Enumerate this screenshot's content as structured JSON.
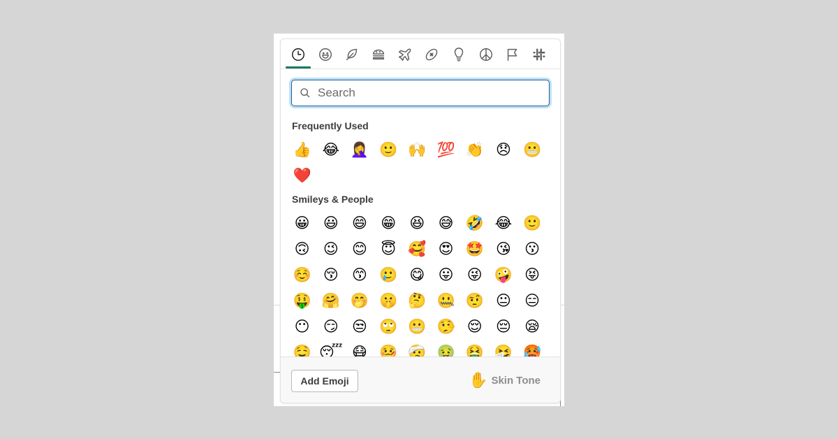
{
  "background": {
    "partial_text": "t"
  },
  "picker": {
    "tabs": [
      {
        "name": "recent",
        "icon": "clock-icon",
        "active": true
      },
      {
        "name": "smileys",
        "icon": "smiley-icon",
        "active": false
      },
      {
        "name": "nature",
        "icon": "leaf-icon",
        "active": false
      },
      {
        "name": "food",
        "icon": "burger-icon",
        "active": false
      },
      {
        "name": "travel",
        "icon": "airplane-icon",
        "active": false
      },
      {
        "name": "activities",
        "icon": "football-icon",
        "active": false
      },
      {
        "name": "objects",
        "icon": "lightbulb-icon",
        "active": false
      },
      {
        "name": "symbols",
        "icon": "peace-icon",
        "active": false
      },
      {
        "name": "flags",
        "icon": "flag-icon",
        "active": false
      },
      {
        "name": "custom",
        "icon": "slack-icon",
        "active": false
      }
    ],
    "accent_color": "#1c7a5a",
    "search": {
      "placeholder": "Search",
      "value": ""
    },
    "sections": [
      {
        "title": "Frequently Used",
        "emojis": [
          "👍",
          "😂",
          "🤦‍♀️",
          "🙂",
          "🙌",
          "💯",
          "👏",
          "😞",
          "😬",
          "❤️"
        ]
      },
      {
        "title": "Smileys & People",
        "emojis": [
          "😀",
          "😃",
          "😄",
          "😁",
          "😆",
          "😅",
          "🤣",
          "😂",
          "🙂",
          "🙃",
          "😉",
          "😊",
          "😇",
          "🥰",
          "😍",
          "🤩",
          "😘",
          "😗",
          "☺️",
          "😚",
          "😙",
          "🥲",
          "😋",
          "😛",
          "😜",
          "🤪",
          "😝",
          "🤑",
          "🤗",
          "🤭",
          "🤫",
          "🤔",
          "🤐",
          "🤨",
          "😐",
          "😑",
          "😶",
          "😏",
          "😒",
          "🙄",
          "😬",
          "🤥",
          "😌",
          "😔",
          "😪",
          "🤤",
          "😴",
          "😷",
          "🤒",
          "🤕",
          "🤢",
          "🤮",
          "🤧",
          "🥵"
        ]
      }
    ],
    "footer": {
      "add_emoji_label": "Add Emoji",
      "skin_tone_icon": "✋",
      "skin_tone_label": "Skin Tone"
    }
  }
}
